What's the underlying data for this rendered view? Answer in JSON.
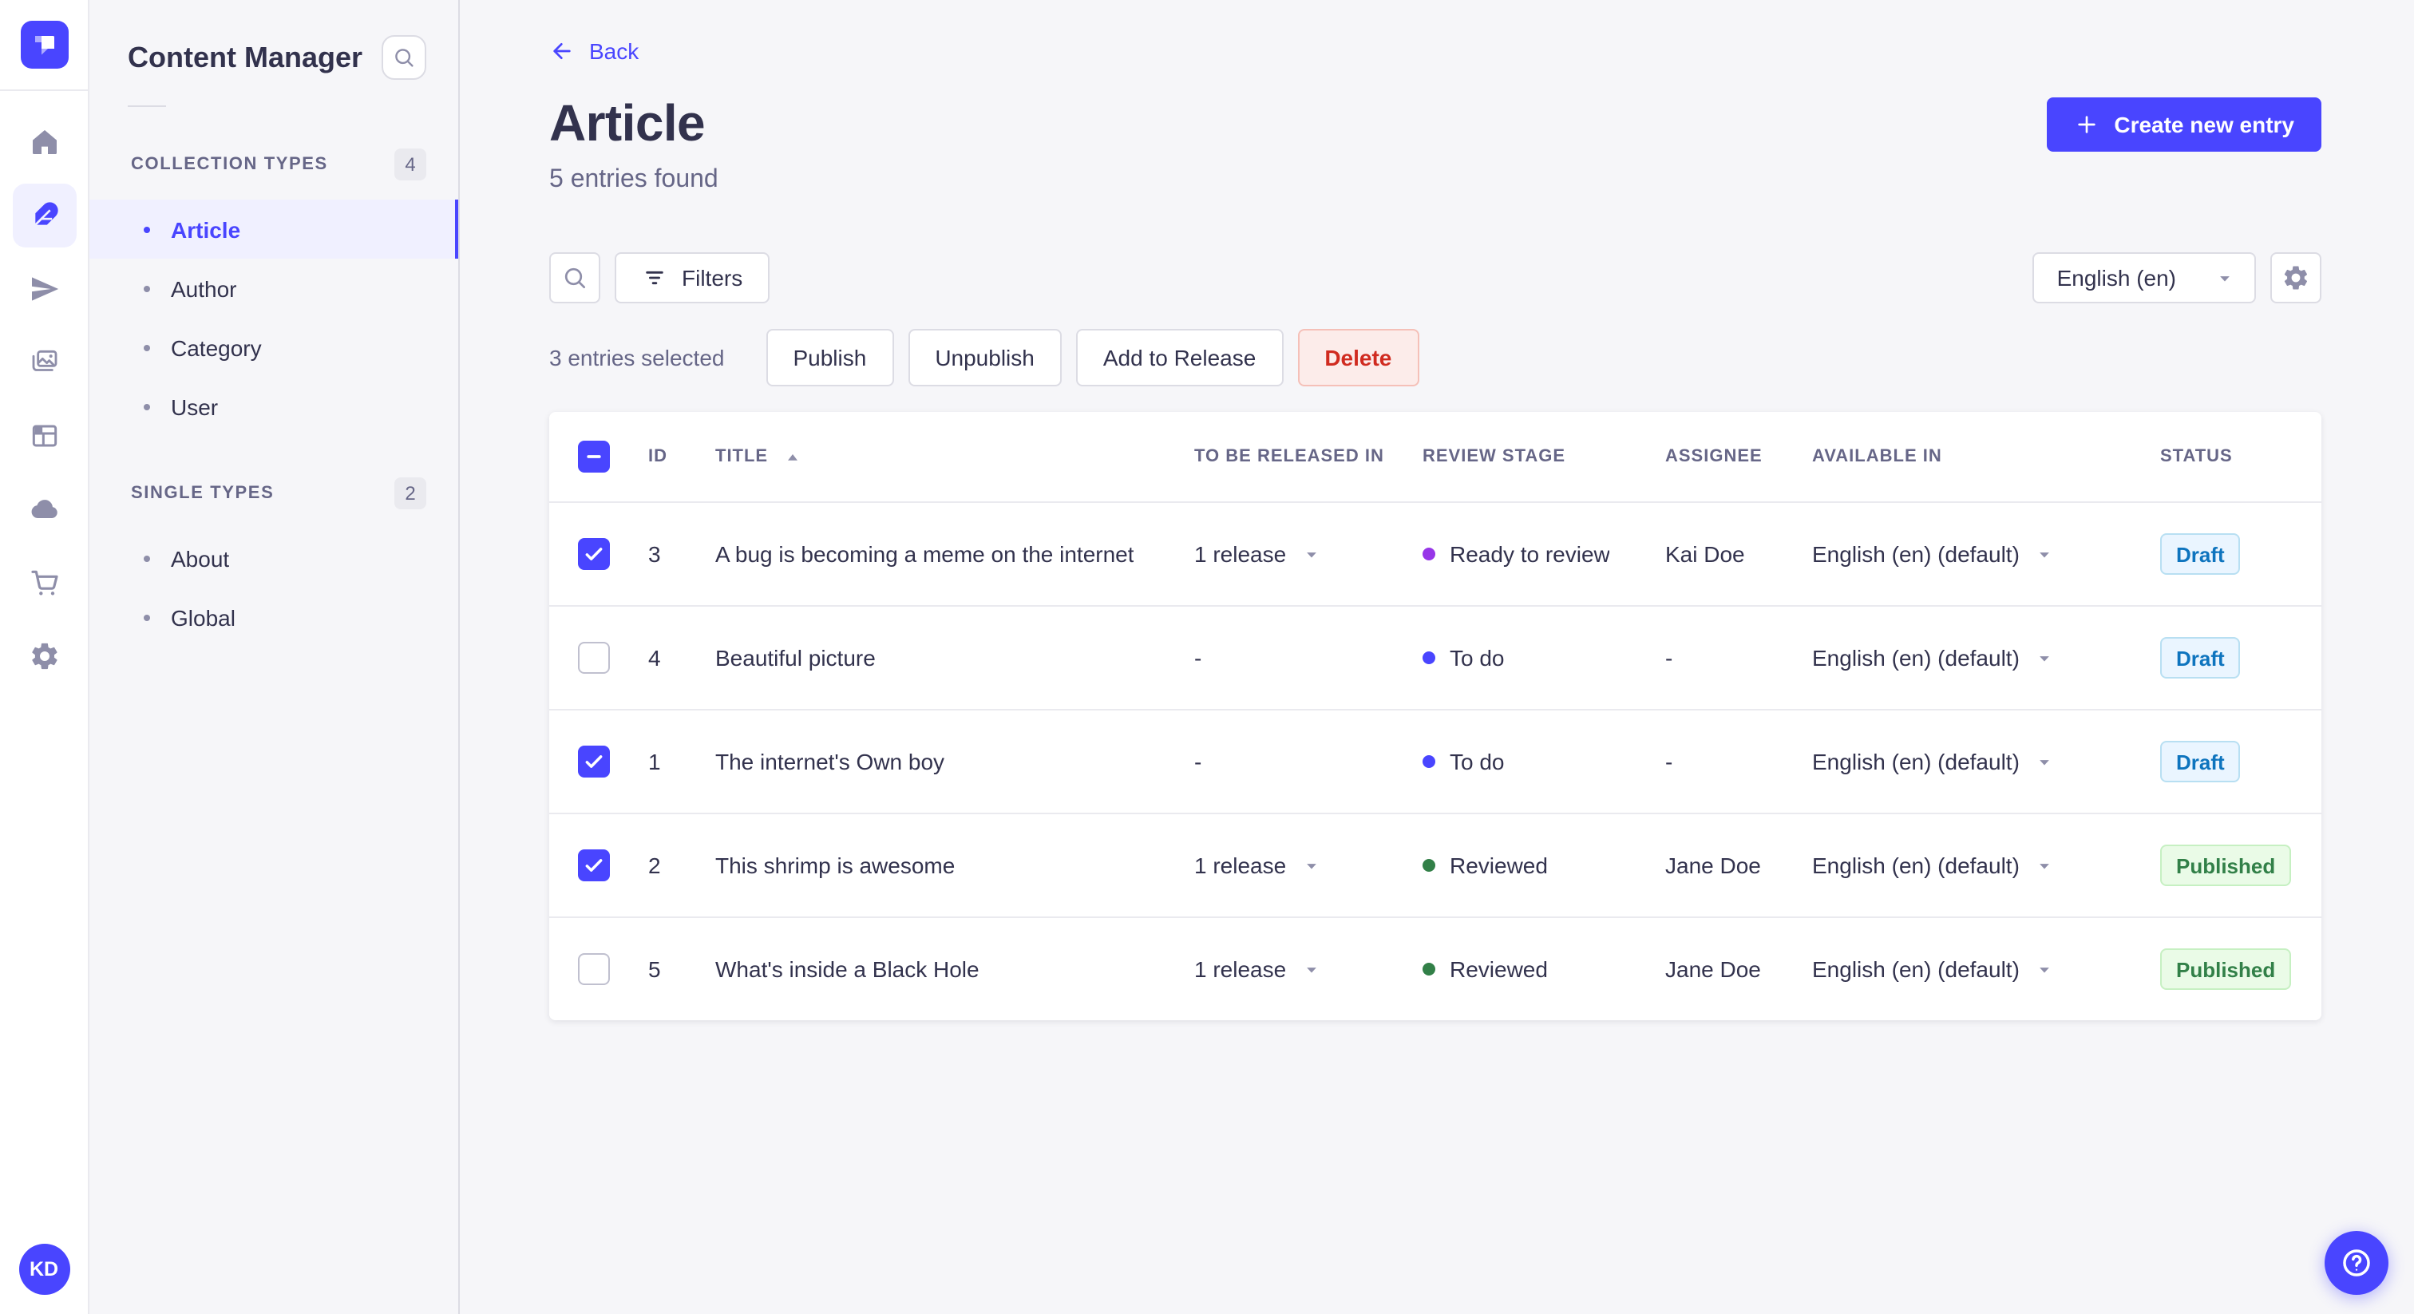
{
  "theme": {
    "primary": "#4945FF",
    "primary_light_bg": "#F0F0FF",
    "draft_badge": {
      "bg": "#EAF5FF",
      "border": "#B8DFF2",
      "text": "#0E74BE"
    },
    "published_badge": {
      "bg": "#EAFBE7",
      "border": "#C6F0C2",
      "text": "#328048"
    },
    "danger": {
      "bg": "#FCECEA",
      "border": "#F5C0B8",
      "text": "#D02B20"
    }
  },
  "nav_rail": {
    "logo_icon": "strapi-logo",
    "items": [
      {
        "icon": "home-icon",
        "active": false
      },
      {
        "icon": "feather-icon",
        "active": true
      },
      {
        "icon": "paper-plane-icon",
        "active": false
      },
      {
        "icon": "images-icon",
        "active": false
      },
      {
        "icon": "layout-icon",
        "active": false
      },
      {
        "icon": "cloud-icon",
        "active": false
      },
      {
        "icon": "cart-icon",
        "active": false
      },
      {
        "icon": "gear-icon",
        "active": false
      }
    ],
    "avatar_initials": "KD"
  },
  "sidebar": {
    "title": "Content Manager",
    "search_icon": "search-icon",
    "sections": [
      {
        "label": "COLLECTION TYPES",
        "count": "4",
        "items": [
          {
            "label": "Article",
            "active": true
          },
          {
            "label": "Author",
            "active": false
          },
          {
            "label": "Category",
            "active": false
          },
          {
            "label": "User",
            "active": false
          }
        ]
      },
      {
        "label": "SINGLE TYPES",
        "count": "2",
        "items": [
          {
            "label": "About",
            "active": false
          },
          {
            "label": "Global",
            "active": false
          }
        ]
      }
    ]
  },
  "header": {
    "back_label": "Back",
    "title": "Article",
    "subtitle": "5 entries found",
    "create_button_label": "Create new entry"
  },
  "toolbar": {
    "filters_label": "Filters",
    "locale_value": "English (en)"
  },
  "selection": {
    "label": "3 entries selected",
    "actions": [
      {
        "label": "Publish",
        "variant": "default"
      },
      {
        "label": "Unpublish",
        "variant": "default"
      },
      {
        "label": "Add to Release",
        "variant": "default"
      },
      {
        "label": "Delete",
        "variant": "danger"
      }
    ]
  },
  "table": {
    "columns": [
      "ID",
      "TITLE",
      "TO BE RELEASED IN",
      "REVIEW STAGE",
      "ASSIGNEE",
      "AVAILABLE IN",
      "STATUS"
    ],
    "sorted_by": "TITLE",
    "sort_direction": "asc",
    "select_all_state": "indeterminate",
    "rows": [
      {
        "checked": true,
        "id": "3",
        "title": "A bug is becoming a meme on the internet",
        "release": "1 release",
        "stage": "Ready to review",
        "stage_color": "#9736E8",
        "assignee": "Kai Doe",
        "available": "English (en) (default)",
        "status": "Draft"
      },
      {
        "checked": false,
        "id": "4",
        "title": "Beautiful picture",
        "release": "-",
        "stage": "To do",
        "stage_color": "#4945FF",
        "assignee": "-",
        "available": "English (en) (default)",
        "status": "Draft"
      },
      {
        "checked": true,
        "id": "1",
        "title": "The internet's Own boy",
        "release": "-",
        "stage": "To do",
        "stage_color": "#4945FF",
        "assignee": "-",
        "available": "English (en) (default)",
        "status": "Draft"
      },
      {
        "checked": true,
        "id": "2",
        "title": "This shrimp is awesome",
        "release": "1 release",
        "stage": "Reviewed",
        "stage_color": "#328048",
        "assignee": "Jane Doe",
        "available": "English (en) (default)",
        "status": "Published"
      },
      {
        "checked": false,
        "id": "5",
        "title": "What's inside a Black Hole",
        "release": "1 release",
        "stage": "Reviewed",
        "stage_color": "#328048",
        "assignee": "Jane Doe",
        "available": "English (en) (default)",
        "status": "Published"
      }
    ]
  },
  "fab": {
    "icon": "question-mark-icon"
  }
}
